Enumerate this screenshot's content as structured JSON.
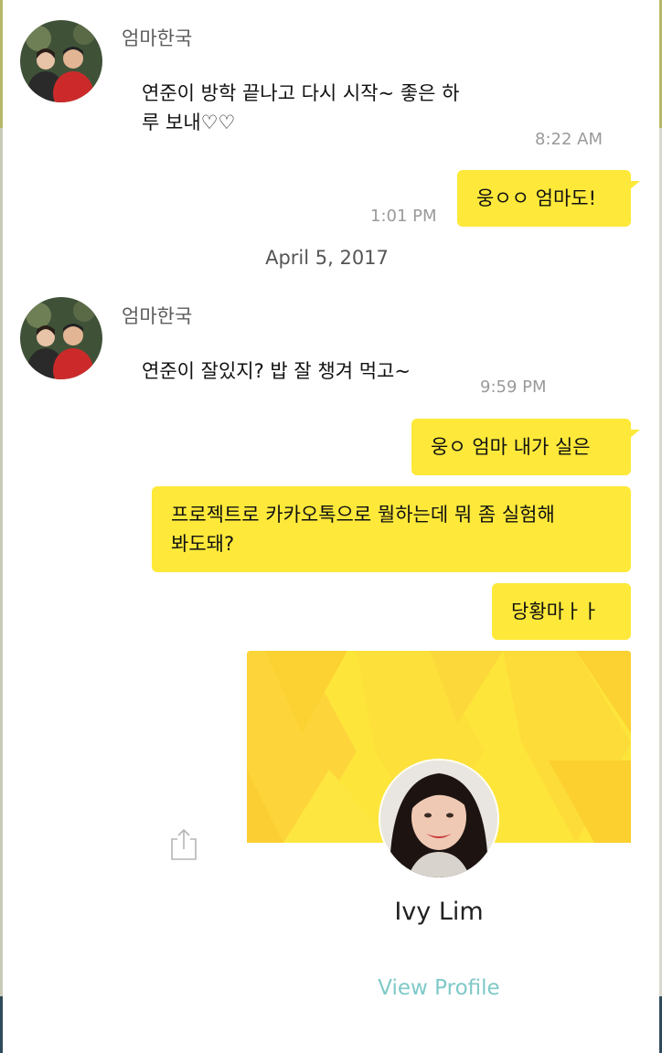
{
  "messages": {
    "group1": {
      "sender": "엄마한국",
      "text_line1": "연준이 방학 끝나고 다시 시작~ 좋은 하",
      "text_line2": "루 보내♡♡",
      "time": "8:22 AM"
    },
    "reply1": {
      "text": "웅ㅇㅇ 엄마도!",
      "time": "1:01 PM"
    },
    "date_separator": "April 5, 2017",
    "group2": {
      "sender": "엄마한국",
      "text": "연준이 잘있지? 밥 잘 챙겨 먹고~",
      "time": "9:59 PM"
    },
    "outgoing": {
      "msg1": "웅ㅇ 엄마 내가 실은",
      "msg2_line1": "프로젝트로 카카오톡으로 뭘하는데 뭐 좀 실험해",
      "msg2_line2": "봐도돼?",
      "msg3": "당황마ㅏㅏ"
    }
  },
  "profile_card": {
    "name": "Ivy Lim",
    "action": "View Profile"
  },
  "icons": {
    "share": "share-icon",
    "sender_avatar": "avatar-photo",
    "profile_photo": "profile-photo"
  },
  "colors": {
    "bubble": "#fee93a",
    "link": "#7fc9c8",
    "time": "#9a9a9a"
  }
}
